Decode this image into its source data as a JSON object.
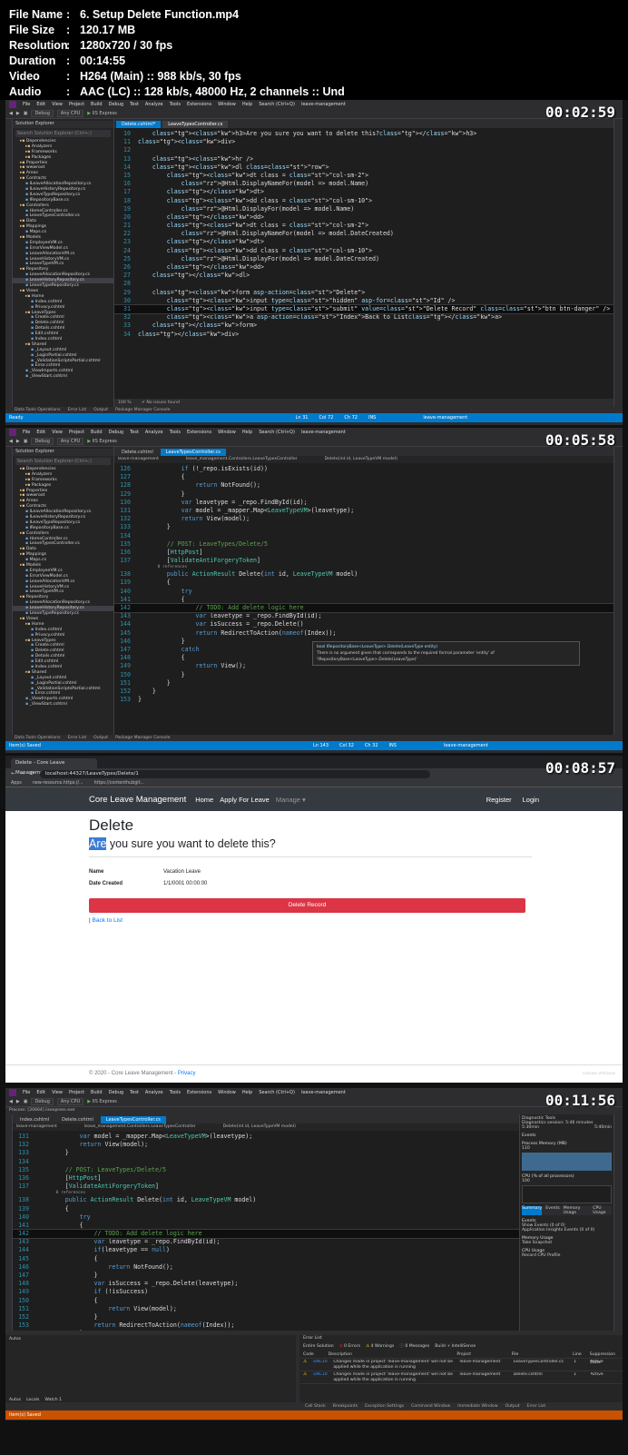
{
  "info": [
    {
      "key": "File Name",
      "value": "6. Setup Delete Function.mp4"
    },
    {
      "key": "File Size",
      "value": "120.17 MB"
    },
    {
      "key": "Resolution",
      "value": "1280x720 / 30 fps"
    },
    {
      "key": "Duration",
      "value": "00:14:55"
    },
    {
      "key": "Video",
      "value": "H264 (Main) :: 988 kb/s, 30 fps"
    },
    {
      "key": "Audio",
      "value": "AAC (LC) :: 128 kb/s, 48000 Hz, 2 channels :: Und"
    }
  ],
  "timestamps": [
    "00:02:59",
    "00:05:58",
    "00:08:57",
    "00:11:56"
  ],
  "vs": {
    "menu": [
      "File",
      "Edit",
      "View",
      "Project",
      "Build",
      "Debug",
      "Test",
      "Analyze",
      "Tools",
      "Extensions",
      "Window",
      "Help",
      "Search (Ctrl+Q)",
      "leave-management"
    ],
    "toolbar": {
      "config": "Debug",
      "platform": "Any CPU",
      "run": "IIS Express"
    },
    "solution_explorer": "Solution Explorer",
    "search_placeholder": "Search Solution Explorer (Ctrl+;)",
    "tree": [
      "Dependencies",
      "Analyzers",
      "Frameworks",
      "Packages",
      "Properties",
      "wwwroot",
      "Areas",
      "Contracts",
      "ILeaveAllocationRepository.cs",
      "ILeaveHistoryRepository.cs",
      "ILeaveTypeRepository.cs",
      "IRepositoryBase.cs",
      "Controllers",
      "HomeController.cs",
      "LeaveTypesController.cs",
      "Data",
      "Mappings",
      "Maps.cs",
      "Models",
      "EmployeeVM.cs",
      "ErrorViewModel.cs",
      "LeaveAllocationVM.cs",
      "LeaveHistoryVM.cs",
      "LeaveTypeVM.cs",
      "Repository",
      "LeaveAllocationRepository.cs",
      "LeaveHistoryRepository.cs",
      "LeaveTypeRepository.cs",
      "Views",
      "Home",
      "Index.cshtml",
      "Privacy.cshtml",
      "LeaveTypes",
      "Create.cshtml",
      "Delete.cshtml",
      "Details.cshtml",
      "Edit.cshtml",
      "Index.cshtml",
      "Shared",
      "_Layout.cshtml",
      "_LoginPartial.cshtml",
      "_ValidationScriptsPartial.cshtml",
      "Error.cshtml",
      "_ViewImports.cshtml",
      "_ViewStart.cshtml"
    ],
    "bottom_tabs": [
      "Data Tools Operations",
      "Error List",
      "Output",
      "Package Manager Console"
    ],
    "frame1": {
      "tabs": [
        "Delete.cshtml*",
        "LeaveTypesController.cs"
      ],
      "status_ready": "Ready",
      "status_pos": [
        "Ln 31",
        "Col 72",
        "Ch 72",
        "INS"
      ],
      "status_right": "leave-management",
      "zoom": "100 %",
      "issues": "No issues found"
    },
    "frame2": {
      "tabs": [
        "Delete.cshtml",
        "LeaveTypesController.cs"
      ],
      "crumbs": [
        "leave-management",
        "leave_management.Controllers.LeaveTypesController",
        "Delete(int id, LeaveTypeVM model)"
      ],
      "status_ready": "Item(s) Saved",
      "status_pos": [
        "Ln 143",
        "Col 32",
        "Ch 32",
        "INS"
      ],
      "tooltip_title": "bool IRepositoryBase<LeaveType>.Delete(LeaveType entity)",
      "tooltip_body": "There is no argument given that corresponds to the required formal parameter 'entity' of 'IRepositoryBase<LeaveType>.Delete(LeaveType)'"
    },
    "frame4": {
      "tabs": [
        "Index.cshtml",
        "Delete.cshtml",
        "LeaveTypesController.cs"
      ],
      "process": "Process: [20664] iisexpress.exe",
      "status_ready": "Item(s) Saved",
      "diag": {
        "title": "Diagnostic Tools",
        "session": "Diagnostics session: 5:46 minutes",
        "t1": "5:30min",
        "t2": "5:40min",
        "events": "Events",
        "mem": "Process Memory (MB)",
        "mem_max": "110",
        "cpu": "CPU (% of all processors)",
        "cpu_max": "100",
        "tabs": [
          "Summary",
          "Events",
          "Memory Usage",
          "CPU Usage"
        ],
        "ev1": "Show Events (0 of 0)",
        "ev2": "Application Insights Events (0 of 0)",
        "memu": "Memory Usage",
        "snap": "Take Snapshot",
        "cpuu": "CPU Usage",
        "rec": "Record CPU Profile"
      },
      "error_list": {
        "title": "Error List",
        "scope": "Entire Solution",
        "errors": "0 Errors",
        "warnings": "4 Warnings",
        "messages": "0 Messages",
        "build": "Build + IntelliSense",
        "cols": [
          "Code",
          "Description",
          "Project",
          "File",
          "Line",
          "Suppression State"
        ],
        "rows": [
          {
            "code": "ENC1005",
            "desc": "Changes made in project 'leave-management' will not be applied while the application is running",
            "project": "leave-management",
            "file": "LeaveTypesController.cs",
            "line": "1",
            "state": "Active"
          },
          {
            "code": "ENC1005",
            "desc": "Changes made in project 'leave-management' will not be applied while the application is running",
            "project": "leave-management",
            "file": "Delete.cshtml",
            "line": "1",
            "state": "Active"
          }
        ]
      },
      "autos": "Autos",
      "locals_tabs": [
        "Autos",
        "Locals",
        "Watch 1"
      ],
      "bottom": [
        "Call Stack",
        "Breakpoints",
        "Exception Settings",
        "Command Window",
        "Immediate Window",
        "Output",
        "Error List"
      ]
    }
  },
  "browser": {
    "tab": "Delete - Core Leave Management",
    "url": "localhost:44327/LeaveTypes/Delete/1",
    "bookmarks": [
      "Apps",
      "new-resource.https://...",
      "https://contenthubgit..."
    ],
    "brand": "Core Leave Management",
    "nav": [
      "Home",
      "Apply For Leave"
    ],
    "manage": "Manage",
    "right": [
      "Register",
      "Login"
    ],
    "h1": "Delete",
    "h3_highlight": "Are",
    "h3_rest": " you sure you want to delete this?",
    "fields": [
      {
        "label": "Name",
        "value": "Vacation Leave"
      },
      {
        "label": "Date Created",
        "value": "1/1/0001 00:00:00"
      }
    ],
    "button": "Delete Record",
    "back_sep": "|",
    "back": "Back to List",
    "footer_text": "© 2020 - Core Leave Management - ",
    "footer_link": "Privacy",
    "watermark": "Activate Windows"
  },
  "code1": {
    "start": 10,
    "lines": [
      "    <h3>Are you sure you want to delete this?</h3>",
      "<div>",
      "",
      "    <hr />",
      "    <dl class=\"row\">",
      "        <dt class = \"col-sm-2\">",
      "            @Html.DisplayNameFor(model => model.Name)",
      "        </dt>",
      "        <dd class = \"col-sm-10\">",
      "            @Html.DisplayFor(model => model.Name)",
      "        </dd>",
      "        <dt class = \"col-sm-2\">",
      "            @Html.DisplayNameFor(model => model.DateCreated)",
      "        </dt>",
      "        <dd class = \"col-sm-10\">",
      "            @Html.DisplayFor(model => model.DateCreated)",
      "        </dd>",
      "    </dl>",
      "",
      "    <form asp-action=\"Delete\">",
      "        <input type=\"hidden\" asp-for=\"Id\" />",
      "        <input type=\"submit\" value=\"Delete Record\" class=\"btn btn-danger\" />",
      "        <a asp-action=\"Index\">Back to List</a>",
      "    </form>",
      "</div>"
    ],
    "current": 21
  },
  "code2": {
    "lines": [
      {
        "n": "126",
        "t": "            if (!_repo.isExists(id))"
      },
      {
        "n": "127",
        "t": "            {"
      },
      {
        "n": "128",
        "t": "                return NotFound();"
      },
      {
        "n": "129",
        "t": "            }"
      },
      {
        "n": "130",
        "t": "            var leavetype = _repo.FindById(id);"
      },
      {
        "n": "131",
        "t": "            var model = _mapper.Map<LeaveTypeVM>(leavetype);"
      },
      {
        "n": "132",
        "t": "            return View(model);"
      },
      {
        "n": "133",
        "t": "        }"
      },
      {
        "n": "134",
        "t": ""
      },
      {
        "n": "135",
        "t": "        // POST: LeaveTypes/Delete/5"
      },
      {
        "n": "136",
        "t": "        [HttpPost]"
      },
      {
        "n": "137",
        "t": "        [ValidateAntiForgeryToken]"
      },
      {
        "n": "",
        "t": "        0 references"
      },
      {
        "n": "138",
        "t": "        public ActionResult Delete(int id, LeaveTypeVM model)"
      },
      {
        "n": "139",
        "t": "        {"
      },
      {
        "n": "140",
        "t": "            try"
      },
      {
        "n": "141",
        "t": "            {"
      },
      {
        "n": "142",
        "t": "                // TODO: Add delete logic here"
      },
      {
        "n": "143",
        "t": "                var leavetype = _repo.FindById(id);"
      },
      {
        "n": "144",
        "t": "                var isSuccess = _repo.Delete()"
      },
      {
        "n": "145",
        "t": "                return RedirectToAction(nameof(Index));"
      },
      {
        "n": "146",
        "t": "            }"
      },
      {
        "n": "147",
        "t": "            catch"
      },
      {
        "n": "148",
        "t": "            {"
      },
      {
        "n": "149",
        "t": "                return View();"
      },
      {
        "n": "150",
        "t": "            }"
      },
      {
        "n": "151",
        "t": "        }"
      },
      {
        "n": "152",
        "t": "    }"
      },
      {
        "n": "153",
        "t": "}"
      }
    ],
    "current": 17
  },
  "code4": {
    "lines": [
      {
        "n": "131",
        "t": "            var model = _mapper.Map<LeaveTypeVM>(leavetype);"
      },
      {
        "n": "132",
        "t": "            return View(model);"
      },
      {
        "n": "133",
        "t": "        }"
      },
      {
        "n": "134",
        "t": ""
      },
      {
        "n": "135",
        "t": "        // POST: LeaveTypes/Delete/5"
      },
      {
        "n": "136",
        "t": "        [HttpPost]"
      },
      {
        "n": "137",
        "t": "        [ValidateAntiForgeryToken]"
      },
      {
        "n": "",
        "t": "        0 references"
      },
      {
        "n": "138",
        "t": "        public ActionResult Delete(int id, LeaveTypeVM model)"
      },
      {
        "n": "139",
        "t": "        {"
      },
      {
        "n": "140",
        "t": "            try"
      },
      {
        "n": "141",
        "t": "            {"
      },
      {
        "n": "142",
        "t": "                // TODO: Add delete logic here"
      },
      {
        "n": "143",
        "t": "                var leavetype = _repo.FindById(id);"
      },
      {
        "n": "144",
        "t": "                if(leavetype == null)"
      },
      {
        "n": "145",
        "t": "                {"
      },
      {
        "n": "146",
        "t": "                    return NotFound();"
      },
      {
        "n": "147",
        "t": "                }"
      },
      {
        "n": "148",
        "t": "                var isSuccess = _repo.Delete(leavetype);"
      },
      {
        "n": "149",
        "t": "                if (!isSuccess)"
      },
      {
        "n": "150",
        "t": "                {"
      },
      {
        "n": "151",
        "t": "                    return View(model);"
      },
      {
        "n": "152",
        "t": "                }"
      },
      {
        "n": "153",
        "t": "                return RedirectToAction(nameof(Index));"
      },
      {
        "n": "154",
        "t": "            }"
      }
    ],
    "current": 12
  },
  "colors": {
    "vs_blue": "#007acc",
    "vs_orange": "#ca5100",
    "bootstrap_red": "#dc3545",
    "navbar": "#343a40"
  }
}
